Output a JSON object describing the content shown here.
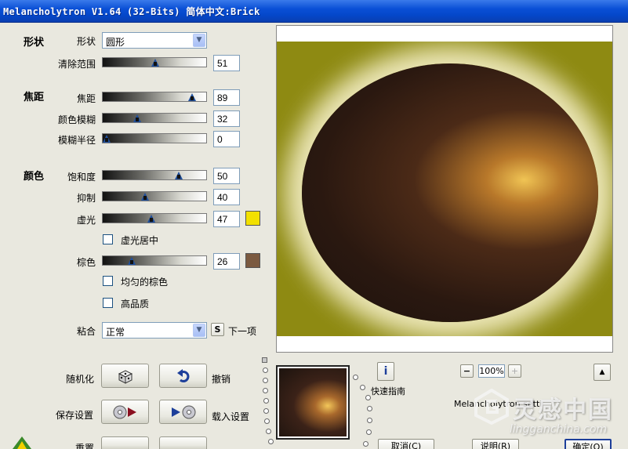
{
  "window": {
    "title": "Melancholytron V1.64 (32-Bits) 简体中文:Brick"
  },
  "shape_section": {
    "heading": "形状",
    "shape_label": "形状",
    "shape_value": "圆形",
    "clear_range_label": "清除范围",
    "clear_range_value": "51",
    "clear_range_level": 0.51
  },
  "focus_section": {
    "heading": "焦距",
    "focus_label": "焦距",
    "focus_value": "89",
    "focus_level": 0.89,
    "color_blur_label": "颜色模糊",
    "color_blur_value": "32",
    "color_blur_level": 0.32,
    "blur_radius_label": "模糊半径",
    "blur_radius_value": "0",
    "blur_radius_level": 0.0
  },
  "color_section": {
    "heading": "颜色",
    "saturation_label": "饱和度",
    "saturation_value": "50",
    "saturation_level": 0.75,
    "suppress_label": "抑制",
    "suppress_value": "40",
    "suppress_level": 0.4,
    "vignette_label": "虚光",
    "vignette_value": "47",
    "vignette_level": 0.47,
    "vignette_color": "#f2e000",
    "vignette_center_label": "虚光居中",
    "brown_label": "棕色",
    "brown_value": "26",
    "brown_level": 0.26,
    "brown_color": "#7b5a40",
    "even_brown_label": "均匀的棕色",
    "high_quality_label": "高品质"
  },
  "blend": {
    "label": "粘合",
    "value": "正常",
    "s_button": "S",
    "next_label": "下一项"
  },
  "actions": {
    "randomize_label": "随机化",
    "undo_label": "撤销",
    "save_settings_label": "保存设置",
    "load_settings_label": "载入设置",
    "reset_label": "重置"
  },
  "preview_panel": {
    "zoom_value": "100%",
    "zoom_minus": "−",
    "zoom_plus": "+",
    "up_button": "▲",
    "info_button": "i",
    "quick_guide_label": "快速指南",
    "settings_caption": "Melancholytron setti",
    "cancel_button": "取消(C)",
    "help_button": "说明(R)",
    "ok_button": "确定(O)"
  },
  "watermark": {
    "brand": "灵感中国",
    "url": "lingganchina.com"
  }
}
